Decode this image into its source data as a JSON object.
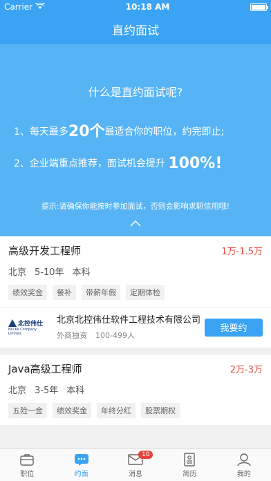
{
  "status_bar": {
    "carrier": "Carrier",
    "time": "10:18 AM"
  },
  "nav": {
    "title": "直约面试"
  },
  "hero": {
    "heading": "什么是直约面试呢?",
    "line1_pre": "1、每天最多",
    "line1_big": "20个",
    "line1_post": "最适合你的职位，约完即止;",
    "line2_pre": "2、企业端重点推荐，面试机会提升",
    "line2_big": "100%!",
    "tip": "提示:请确保你能按时参加面试，否则会影响求职信用哦!"
  },
  "jobs": [
    {
      "title": "高级开发工程师",
      "salary": "1万-1.5万",
      "city": "北京",
      "experience": "5-10年",
      "education": "本科",
      "tags": [
        "绩效奖金",
        "餐补",
        "带薪年假",
        "定期体检"
      ],
      "company": {
        "logo_text": "北控伟仕",
        "logo_sub": "Bei Ke Company Limited",
        "name": "北京北控伟仕软件工程技术有限公司",
        "type": "外商独资",
        "size": "100-499人",
        "button": "我要约"
      }
    },
    {
      "title": "Java高级工程师",
      "salary": "2万-3万",
      "city": "北京",
      "experience": "3-5年",
      "education": "本科",
      "tags": [
        "五险一金",
        "绩效奖金",
        "年终分红",
        "股票期权"
      ]
    }
  ],
  "tabbar": {
    "items": [
      {
        "label": "职位",
        "icon": "briefcase-icon"
      },
      {
        "label": "约面",
        "icon": "chat-icon"
      },
      {
        "label": "消息",
        "icon": "mail-icon",
        "badge": "10"
      },
      {
        "label": "简历",
        "icon": "resume-icon"
      },
      {
        "label": "我的",
        "icon": "profile-icon"
      }
    ]
  },
  "colors": {
    "primary": "#3aa3f3",
    "hero": "#56b4f5",
    "salary": "#e8443a"
  }
}
